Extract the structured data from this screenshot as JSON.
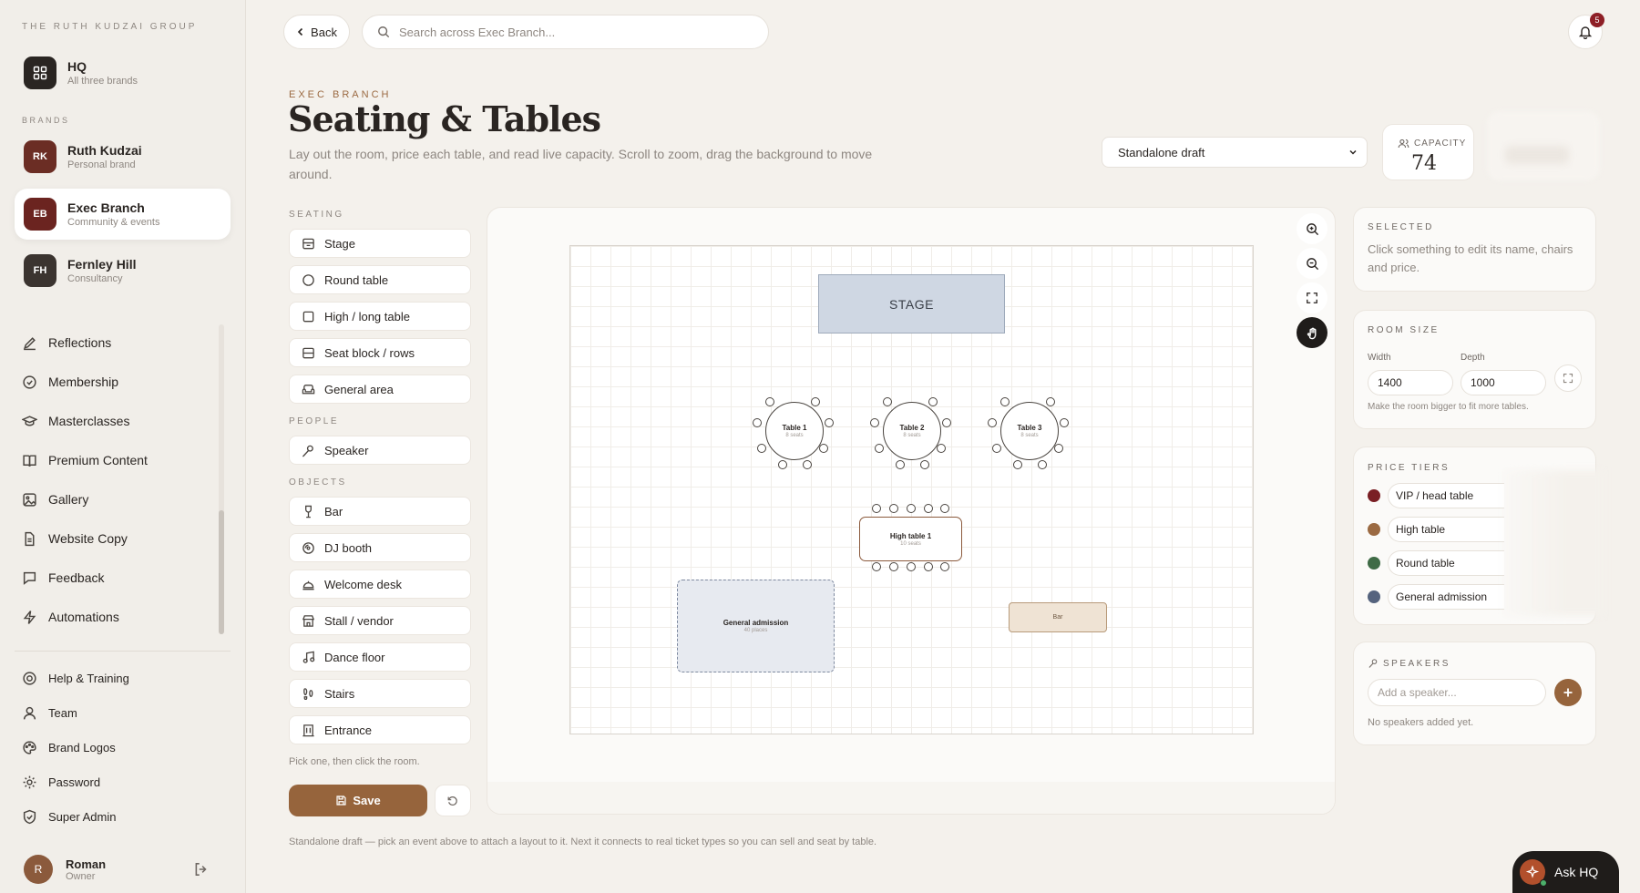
{
  "sidebar": {
    "group_title": "THE RUTH KUDZAI GROUP",
    "hq": {
      "name": "HQ",
      "sub": "All three brands"
    },
    "brands_label": "BRANDS",
    "brands": [
      {
        "initials": "RK",
        "name": "Ruth Kudzai",
        "sub": "Personal brand",
        "color": "#6b2d24"
      },
      {
        "initials": "EB",
        "name": "Exec Branch",
        "sub": "Community & events",
        "color": "#6b2420"
      },
      {
        "initials": "FH",
        "name": "Fernley Hill",
        "sub": "Consultancy",
        "color": "#3b3430"
      }
    ],
    "nav": [
      {
        "label": "Reflections",
        "icon": "pen-icon"
      },
      {
        "label": "Membership",
        "icon": "badge-check-icon"
      },
      {
        "label": "Masterclasses",
        "icon": "graduation-cap-icon"
      },
      {
        "label": "Premium Content",
        "icon": "book-icon"
      },
      {
        "label": "Gallery",
        "icon": "image-icon"
      },
      {
        "label": "Website Copy",
        "icon": "document-icon"
      },
      {
        "label": "Feedback",
        "icon": "message-icon"
      },
      {
        "label": "Automations",
        "icon": "bolt-icon"
      }
    ],
    "nav2": [
      {
        "label": "Help & Training",
        "icon": "lifebuoy-icon"
      },
      {
        "label": "Team",
        "icon": "user-icon"
      },
      {
        "label": "Brand Logos",
        "icon": "palette-icon"
      },
      {
        "label": "Password",
        "icon": "gear-icon"
      },
      {
        "label": "Super Admin",
        "icon": "shield-icon"
      }
    ],
    "user": {
      "initial": "R",
      "name": "Roman",
      "role": "Owner"
    }
  },
  "header": {
    "back_label": "Back",
    "search_placeholder": "Search across Exec Branch...",
    "notifications": "5"
  },
  "page": {
    "eyebrow": "EXEC BRANCH",
    "title": "Seating & Tables",
    "description": "Lay out the room, price each table, and read live capacity. Scroll to zoom, drag the background to move around.",
    "layout_select": "Standalone draft",
    "capacity_label": "CAPACITY",
    "capacity_value": "74",
    "footer_note": "Standalone draft — pick an event above to attach a layout to it. Next it connects to real ticket types so you can sell and seat by table."
  },
  "palette": {
    "seating_label": "SEATING",
    "seating": [
      {
        "label": "Stage",
        "icon": "stage-icon"
      },
      {
        "label": "Round table",
        "icon": "circle-icon"
      },
      {
        "label": "High / long table",
        "icon": "square-icon"
      },
      {
        "label": "Seat block / rows",
        "icon": "rows-icon"
      },
      {
        "label": "General area",
        "icon": "sofa-icon"
      }
    ],
    "people_label": "PEOPLE",
    "people": [
      {
        "label": "Speaker",
        "icon": "mic-icon"
      }
    ],
    "objects_label": "OBJECTS",
    "objects": [
      {
        "label": "Bar",
        "icon": "wine-icon"
      },
      {
        "label": "DJ booth",
        "icon": "disc-icon"
      },
      {
        "label": "Welcome desk",
        "icon": "bell-desk-icon"
      },
      {
        "label": "Stall / vendor",
        "icon": "store-icon"
      },
      {
        "label": "Dance floor",
        "icon": "music-icon"
      },
      {
        "label": "Stairs",
        "icon": "footprints-icon"
      },
      {
        "label": "Entrance",
        "icon": "door-icon"
      }
    ],
    "hint": "Pick one, then click the room.",
    "save_label": "Save"
  },
  "canvas": {
    "stage_label": "STAGE",
    "tables": [
      {
        "name": "Table 1",
        "seats": "8 seats"
      },
      {
        "name": "Table 2",
        "seats": "8 seats"
      },
      {
        "name": "Table 3",
        "seats": "8 seats"
      }
    ],
    "high_table": {
      "name": "High table 1",
      "seats": "10 seats"
    },
    "general_admission": {
      "name": "General admission",
      "places": "40 places"
    },
    "bar_label": "Bar"
  },
  "right": {
    "selected_label": "SELECTED",
    "selected_text": "Click something to edit its name, chairs and price.",
    "room_size_label": "ROOM SIZE",
    "width_label": "Width",
    "width_value": "1400",
    "depth_label": "Depth",
    "depth_value": "1000",
    "room_hint": "Make the room bigger to fit more tables.",
    "price_tiers_label": "PRICE TIERS",
    "tiers": [
      {
        "name": "VIP / head table",
        "color": "#7a1f24"
      },
      {
        "name": "High table",
        "color": "#9b6a42"
      },
      {
        "name": "Round table",
        "color": "#3f6b46"
      },
      {
        "name": "General admission",
        "color": "#55637e"
      }
    ],
    "speakers_label": "SPEAKERS",
    "speaker_placeholder": "Add a speaker...",
    "no_speakers": "No speakers added yet."
  },
  "ask": {
    "label": "Ask HQ"
  }
}
